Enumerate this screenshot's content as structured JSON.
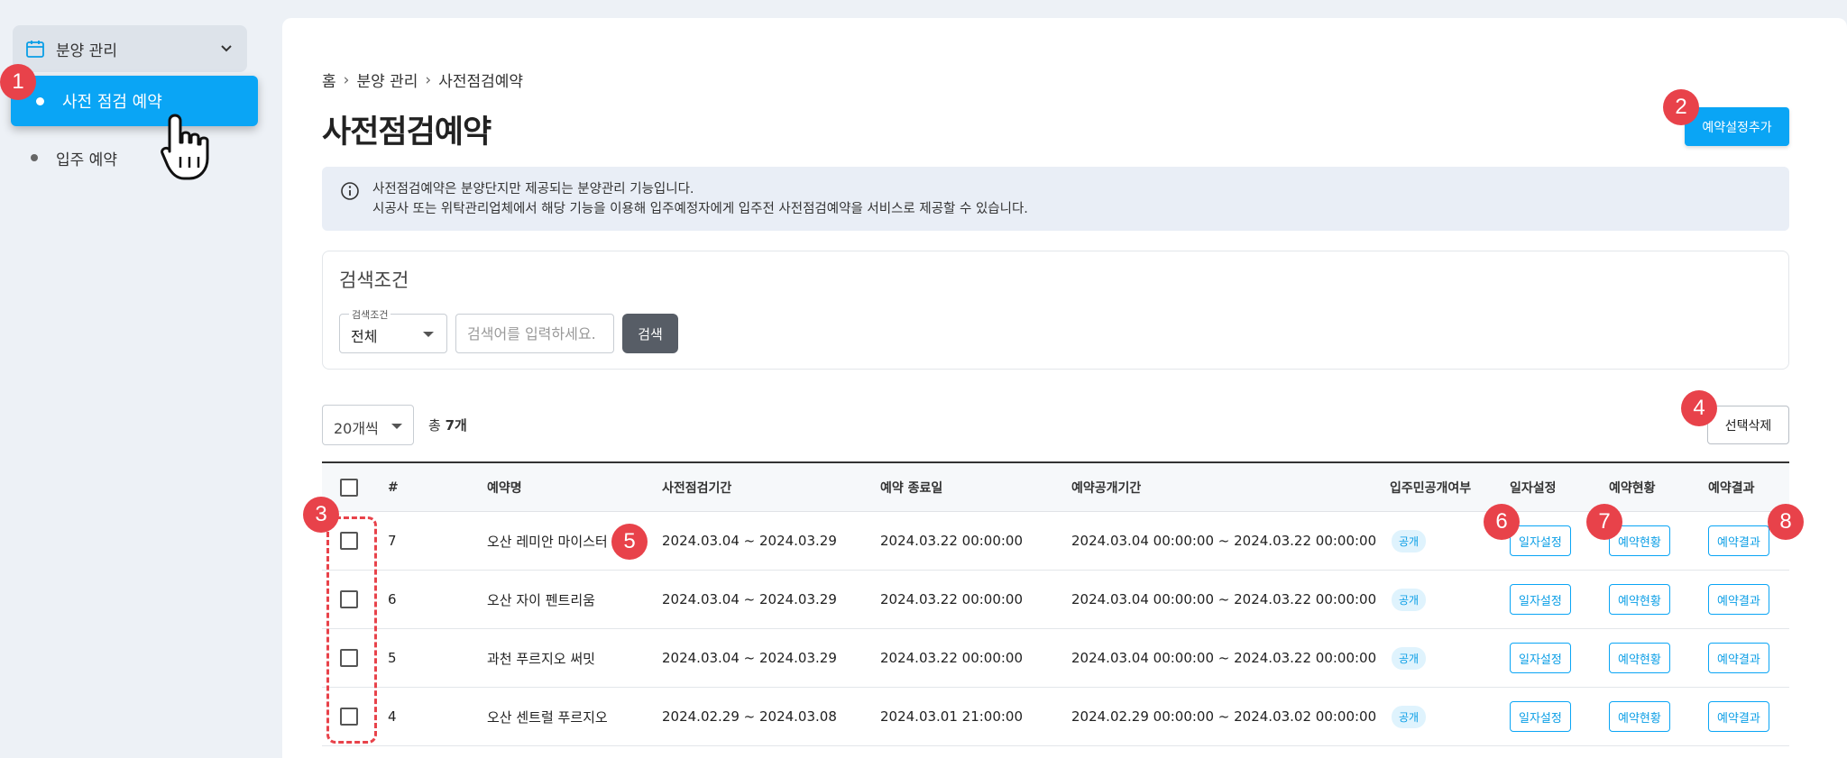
{
  "sidebar": {
    "group_label": "분양 관리",
    "items": [
      {
        "label": "사전 점검 예약",
        "active": true
      },
      {
        "label": "입주 예약",
        "active": false
      }
    ]
  },
  "breadcrumb": [
    "홈",
    "분양 관리",
    "사전점검예약"
  ],
  "page_title": "사전점검예약",
  "add_button": "예약설정추가",
  "info": {
    "line1": "사전점검예약은 분양단지만 제공되는 분양관리 기능입니다.",
    "line2": "시공사 또는 위탁관리업체에서 해당 기능을 이용해 입주예정자에게 입주전 사전점검예약을 서비스로 제공할 수 있습니다."
  },
  "search": {
    "title": "검색조건",
    "select_legend": "검색조건",
    "select_value": "전체",
    "placeholder": "검색어를 입력하세요.",
    "button": "검색"
  },
  "list": {
    "page_size": "20개씩",
    "total_prefix": "총 ",
    "total_count": "7개",
    "delete_button": "선택삭제"
  },
  "table": {
    "headers": {
      "num": "#",
      "name": "예약명",
      "period": "사전점검기간",
      "end_date": "예약 종료일",
      "open_period": "예약공개기간",
      "public": "입주민공개여부",
      "date_setting": "일자설정",
      "status": "예약현황",
      "result": "예약결과"
    },
    "rows": [
      {
        "num": "7",
        "name": "오산 레미안 마이스터",
        "period": "2024.03.04 ~ 2024.03.29",
        "end_date": "2024.03.22 00:00:00",
        "open_period": "2024.03.04 00:00:00 ~ 2024.03.22 00:00:00",
        "public": "공개",
        "date_btn": "일자설정",
        "status_btn": "예약현황",
        "result_btn": "예약결과"
      },
      {
        "num": "6",
        "name": "오산 자이 펜트리움",
        "period": "2024.03.04 ~ 2024.03.29",
        "end_date": "2024.03.22 00:00:00",
        "open_period": "2024.03.04 00:00:00 ~ 2024.03.22 00:00:00",
        "public": "공개",
        "date_btn": "일자설정",
        "status_btn": "예약현황",
        "result_btn": "예약결과"
      },
      {
        "num": "5",
        "name": "과천 푸르지오 써밋",
        "period": "2024.03.04 ~ 2024.03.29",
        "end_date": "2024.03.22 00:00:00",
        "open_period": "2024.03.04 00:00:00 ~ 2024.03.22 00:00:00",
        "public": "공개",
        "date_btn": "일자설정",
        "status_btn": "예약현황",
        "result_btn": "예약결과"
      },
      {
        "num": "4",
        "name": "오산 센트럴 푸르지오",
        "period": "2024.02.29 ~ 2024.03.08",
        "end_date": "2024.03.01 21:00:00",
        "open_period": "2024.02.29 00:00:00 ~ 2024.03.02 00:00:00",
        "public": "공개",
        "date_btn": "일자설정",
        "status_btn": "예약현황",
        "result_btn": "예약결과"
      }
    ]
  },
  "markers": [
    "1",
    "2",
    "3",
    "4",
    "5",
    "6",
    "7",
    "8"
  ],
  "colors": {
    "accent": "#0aa5f5",
    "marker": "#e8424a",
    "dark_button": "#575d66"
  }
}
